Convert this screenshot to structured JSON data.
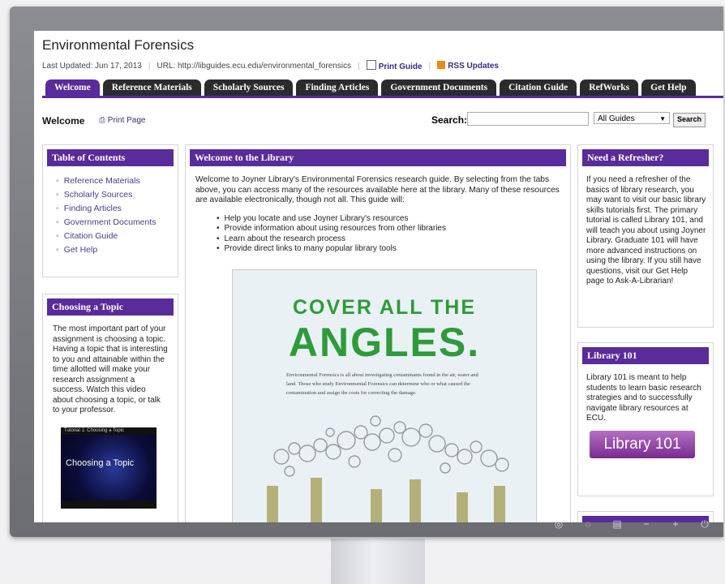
{
  "page": {
    "title": "Environmental Forensics",
    "last_updated": "Last Updated: Jun 17, 2013",
    "url": "URL: http://libguides.ecu.edu/environmental_forensics",
    "print_guide": "Print Guide",
    "rss_updates": "RSS Updates"
  },
  "tabs": [
    {
      "label": "Welcome"
    },
    {
      "label": "Reference Materials"
    },
    {
      "label": "Scholarly Sources"
    },
    {
      "label": "Finding Articles"
    },
    {
      "label": "Government Documents"
    },
    {
      "label": "Citation Guide"
    },
    {
      "label": "RefWorks"
    },
    {
      "label": "Get Help"
    }
  ],
  "subheader": {
    "title": "Welcome",
    "print_page": "Print Page",
    "search_label": "Search:",
    "search_value": "",
    "guide_select": "All Guides",
    "search_button": "Search"
  },
  "left": {
    "toc_title": "Table of Contents",
    "toc": [
      "Reference Materials",
      "Scholarly Sources",
      "Finding Articles",
      "Government Documents",
      "Citation Guide",
      "Get Help"
    ],
    "topic_title": "Choosing a Topic",
    "topic_text": "The most important part of your assignment is choosing a topic. Having a topic that is interesting to you and attainable within the time allotted will make your research assignment a success. Watch this video about choosing a topic, or talk to your professor.",
    "video_title": "Tutorial 1: Choosing a Topic",
    "video_text": "Choosing a Topic"
  },
  "center": {
    "title": "Welcome to the Library",
    "intro": "Welcome to Joyner Library's Environmental Forensics research guide.  By selecting from the tabs above, you can access many of the resources available here at the library.  Many of these resources are available electronically, though not all.  This guide will:",
    "bullets": [
      "Help you locate and use Joyner Library's resources",
      "Provide information about using resources from other libraries",
      "Learn about the research process",
      "Provide direct links to many popular library tools"
    ],
    "poster_line1": "COVER ALL THE",
    "poster_line2": "ANGLES.",
    "poster_desc": "Environmental Forensics is all about investigating contaminants found in the air, water and land. Those who study Environmental Forensics can determine who or what caused the contamination and assign the costs for correcting the damage."
  },
  "right": {
    "refresher_title": "Need a Refresher?",
    "refresher_text": "If you need a refresher of the basics of library research, you may want to visit our basic library skills tutorials first. The primary tutorial is called Library 101, and will teach you about using Joyner Library. Graduate 101 will have more advanced instructions on using the library. If you still have questions, visit our Get Help page to Ask-A-Librarian!",
    "lib101_title": "Library 101",
    "lib101_text": "Library 101 is meant to help students to learn basic research strategies and to successfully navigate library resources at ECU.",
    "lib101_button": "Library 101"
  },
  "colors": {
    "purple": "#5a2b9a",
    "tab_dark": "#2b2b2e",
    "poster_green": "#2f9a3a"
  }
}
